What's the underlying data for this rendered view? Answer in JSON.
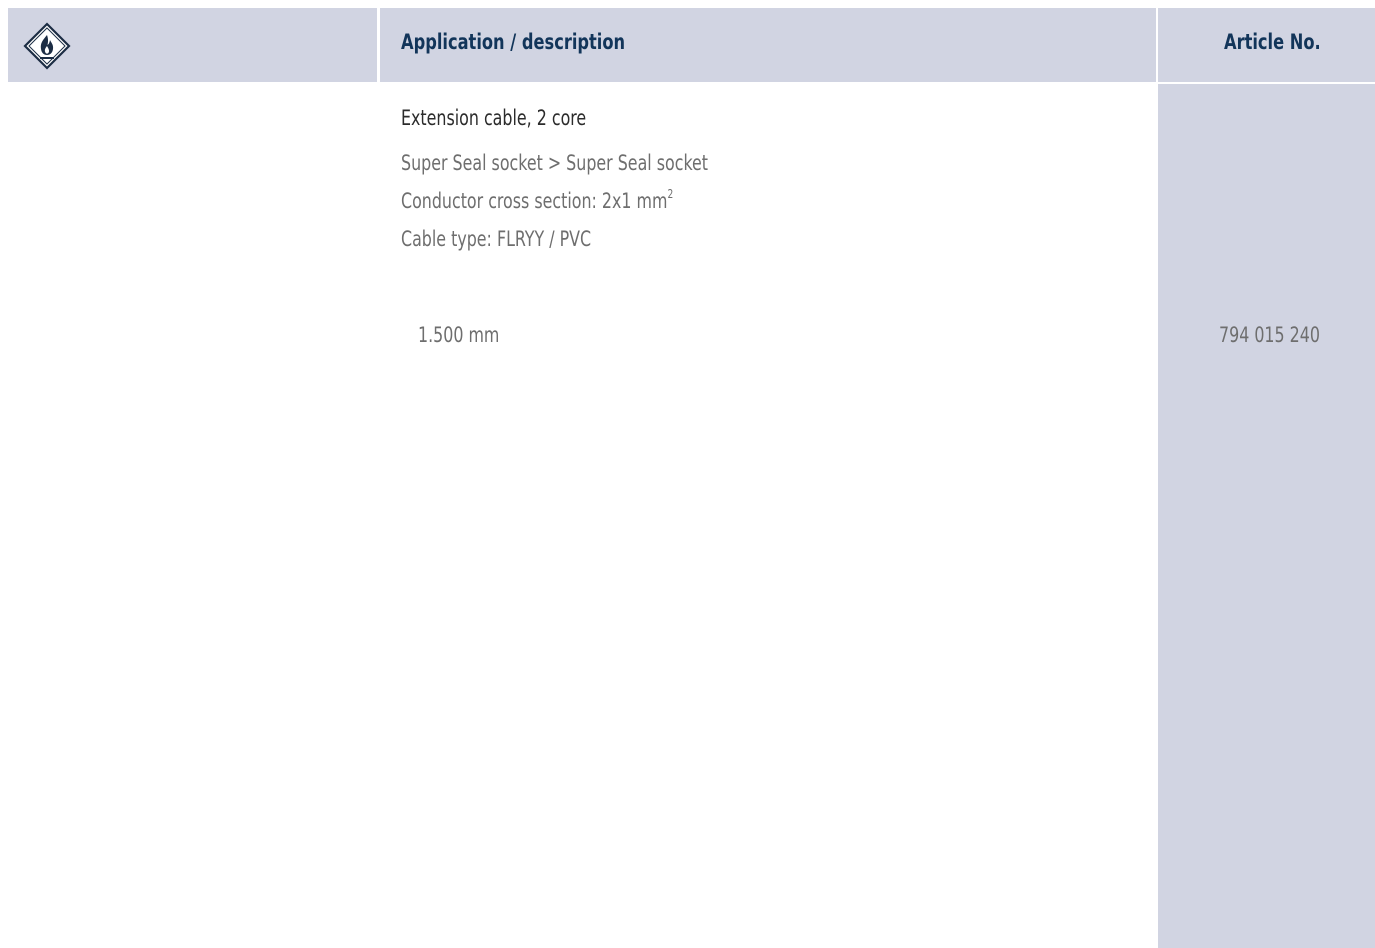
{
  "header": {
    "description_label": "Application / description",
    "article_label": "Article No."
  },
  "icons": {
    "hazard": "flammable-hazard-icon"
  },
  "colors": {
    "header_bg": "#d1d4e2",
    "header_text": "#12355a",
    "title_text": "#2b2b2b",
    "spec_text": "#6e6e6e"
  },
  "product": {
    "title": "Extension cable, 2 core",
    "spec_connection": "Super Seal socket > Super Seal socket",
    "spec_cross_section": "Conductor cross section: 2x1 mm",
    "spec_cross_section_sup": "2",
    "spec_cable_type": "Cable type: FLRYY  / PVC"
  },
  "rows": [
    {
      "length": "1.500 mm",
      "article_no": "794 015 240"
    }
  ]
}
